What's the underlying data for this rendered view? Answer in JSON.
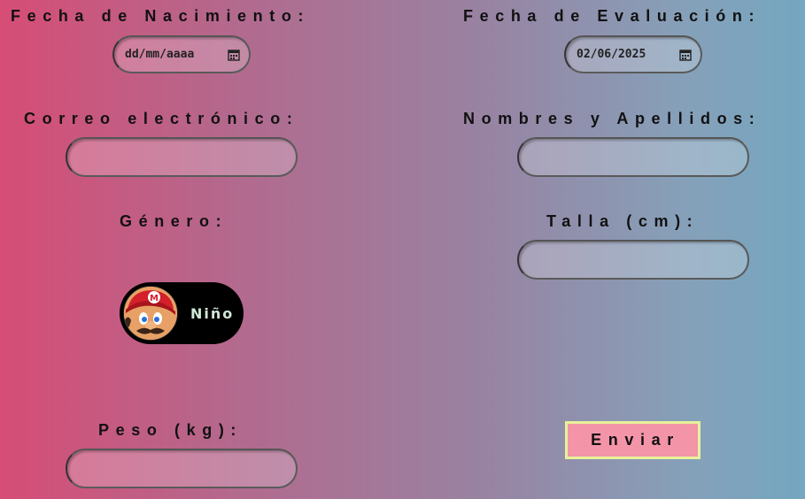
{
  "fields": {
    "birth_date": {
      "label": "Fecha de Nacimiento:",
      "placeholder": "dd/mm/aaaa"
    },
    "eval_date": {
      "label": "Fecha de Evaluación:",
      "value": "02/06/2025"
    },
    "email": {
      "label": "Correo electrónico:",
      "value": ""
    },
    "full_name": {
      "label": "Nombres y Apellidos:",
      "value": ""
    },
    "gender": {
      "label": "Género:",
      "toggle_text": "Niño",
      "avatar_icon": "mario-avatar-icon"
    },
    "height": {
      "label": "Talla (cm):",
      "value": ""
    },
    "weight": {
      "label": "Peso (kg):",
      "value": ""
    }
  },
  "submit": {
    "label": "Enviar"
  },
  "colors": {
    "gradient_left": "#d64d76",
    "gradient_right": "#74a7c0",
    "button_bg": "#f394a8",
    "button_border": "#e8f29a",
    "toggle_bg": "#000000"
  }
}
